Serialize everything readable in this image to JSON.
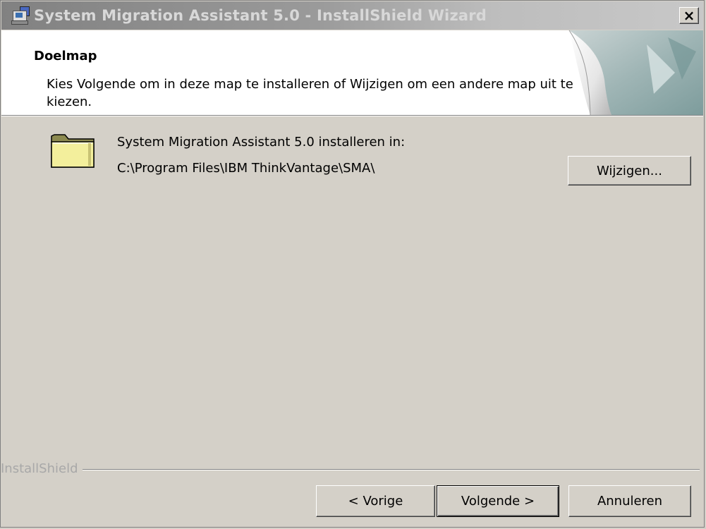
{
  "window": {
    "title": "System Migration Assistant 5.0 - InstallShield Wizard",
    "close_label": "×"
  },
  "header": {
    "title": "Doelmap",
    "description": "Kies Volgende om in deze map te installeren of Wijzigen om een andere map uit te kiezen."
  },
  "destination": {
    "label": "System Migration Assistant 5.0 installeren in:",
    "path": "C:\\Program Files\\IBM ThinkVantage\\SMA\\",
    "change_button": "Wijzigen..."
  },
  "footer": {
    "brand": "InstallShield",
    "back_button": "< Vorige",
    "next_button": "Volgende >",
    "cancel_button": "Annuleren"
  },
  "icons": {
    "app": "installer-computer-icon",
    "folder": "folder-icon",
    "close": "close-icon"
  }
}
